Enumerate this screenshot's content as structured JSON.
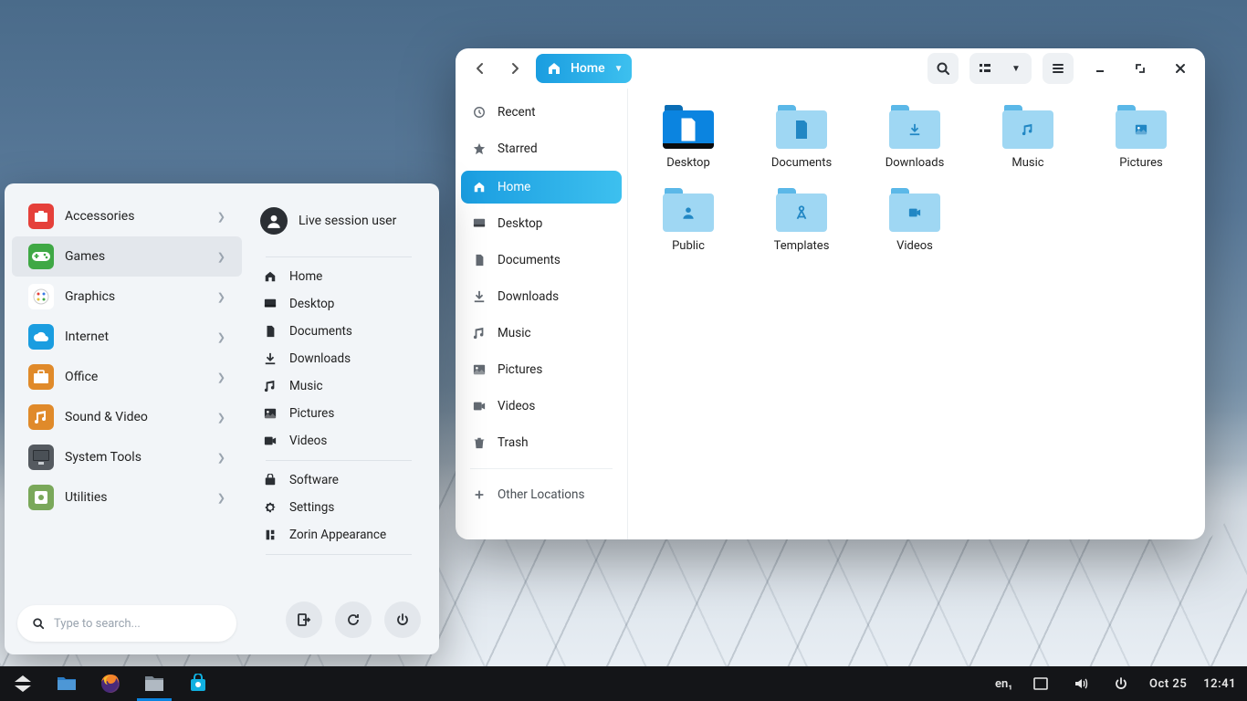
{
  "taskbar": {
    "lang": "en₁",
    "date": "Oct 25",
    "time": "12:41"
  },
  "startmenu": {
    "search_placeholder": "Type to search...",
    "user": "Live session user",
    "categories": [
      {
        "label": "Accessories",
        "icon": "briefcase",
        "color": "#e5403a",
        "active": false
      },
      {
        "label": "Games",
        "icon": "gamepad",
        "color": "#3fa845",
        "active": true
      },
      {
        "label": "Graphics",
        "icon": "palette",
        "color": "#ffffff",
        "active": false
      },
      {
        "label": "Internet",
        "icon": "cloud",
        "color": "#1a9de0",
        "active": false
      },
      {
        "label": "Office",
        "icon": "briefcase2",
        "color": "#e08a2a",
        "active": false
      },
      {
        "label": "Sound & Video",
        "icon": "media",
        "color": "#e08a2a",
        "active": false
      },
      {
        "label": "System Tools",
        "icon": "monitor",
        "color": "#555a60",
        "active": false
      },
      {
        "label": "Utilities",
        "icon": "wrench",
        "color": "#7aa85a",
        "active": false
      }
    ],
    "places": [
      {
        "label": "Home",
        "icon": "home"
      },
      {
        "label": "Desktop",
        "icon": "desktop"
      },
      {
        "label": "Documents",
        "icon": "document"
      },
      {
        "label": "Downloads",
        "icon": "download"
      },
      {
        "label": "Music",
        "icon": "music"
      },
      {
        "label": "Pictures",
        "icon": "picture"
      },
      {
        "label": "Videos",
        "icon": "video"
      }
    ],
    "apps": [
      {
        "label": "Software",
        "icon": "bag"
      },
      {
        "label": "Settings",
        "icon": "gear"
      },
      {
        "label": "Zorin Appearance",
        "icon": "appearance"
      }
    ]
  },
  "filemanager": {
    "path_label": "Home",
    "sidebar": [
      {
        "label": "Recent",
        "icon": "recent"
      },
      {
        "label": "Starred",
        "icon": "star"
      },
      {
        "label": "Home",
        "icon": "home",
        "active": true
      },
      {
        "label": "Desktop",
        "icon": "desktop"
      },
      {
        "label": "Documents",
        "icon": "document"
      },
      {
        "label": "Downloads",
        "icon": "download"
      },
      {
        "label": "Music",
        "icon": "music"
      },
      {
        "label": "Pictures",
        "icon": "picture"
      },
      {
        "label": "Videos",
        "icon": "video"
      },
      {
        "label": "Trash",
        "icon": "trash"
      }
    ],
    "other_locations": "Other Locations",
    "folders": [
      {
        "label": "Desktop",
        "glyph": "doc",
        "variant": "desktop"
      },
      {
        "label": "Documents",
        "glyph": "doc"
      },
      {
        "label": "Downloads",
        "glyph": "download"
      },
      {
        "label": "Music",
        "glyph": "music"
      },
      {
        "label": "Pictures",
        "glyph": "picture"
      },
      {
        "label": "Public",
        "glyph": "person"
      },
      {
        "label": "Templates",
        "glyph": "compass"
      },
      {
        "label": "Videos",
        "glyph": "video"
      }
    ]
  }
}
